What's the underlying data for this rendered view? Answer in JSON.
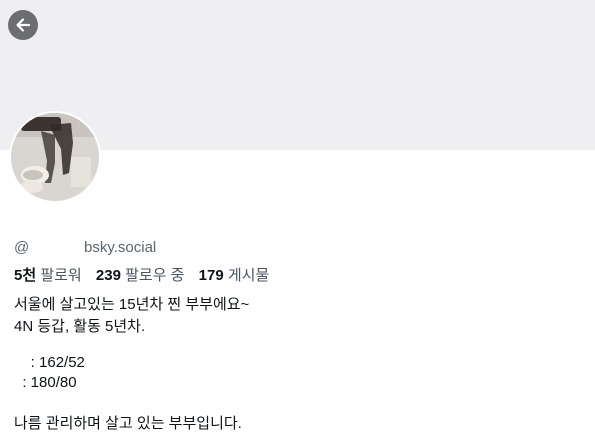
{
  "profile": {
    "handle_prefix": "@",
    "handle_domain": "bsky.social",
    "stats": {
      "followers_count": "5천",
      "followers_label": "팔로워",
      "following_count": "239",
      "following_label": "팔로우 중",
      "posts_count": "179",
      "posts_label": "게시물"
    },
    "bio": {
      "line1": "서울에 살고있는 15년차 찐 부부에요~",
      "line2": "4N 등갑, 활동 5년차.",
      "line3": "    : 162/52",
      "line4": "  : 180/80",
      "line5": "나름 관리하며 살고 있는 부부입니다."
    }
  },
  "colors": {
    "banner": "#efeff1",
    "back_button": "#6b6d70",
    "muted_text": "#5b6670"
  },
  "icons": {
    "back": "arrow-left-icon"
  }
}
